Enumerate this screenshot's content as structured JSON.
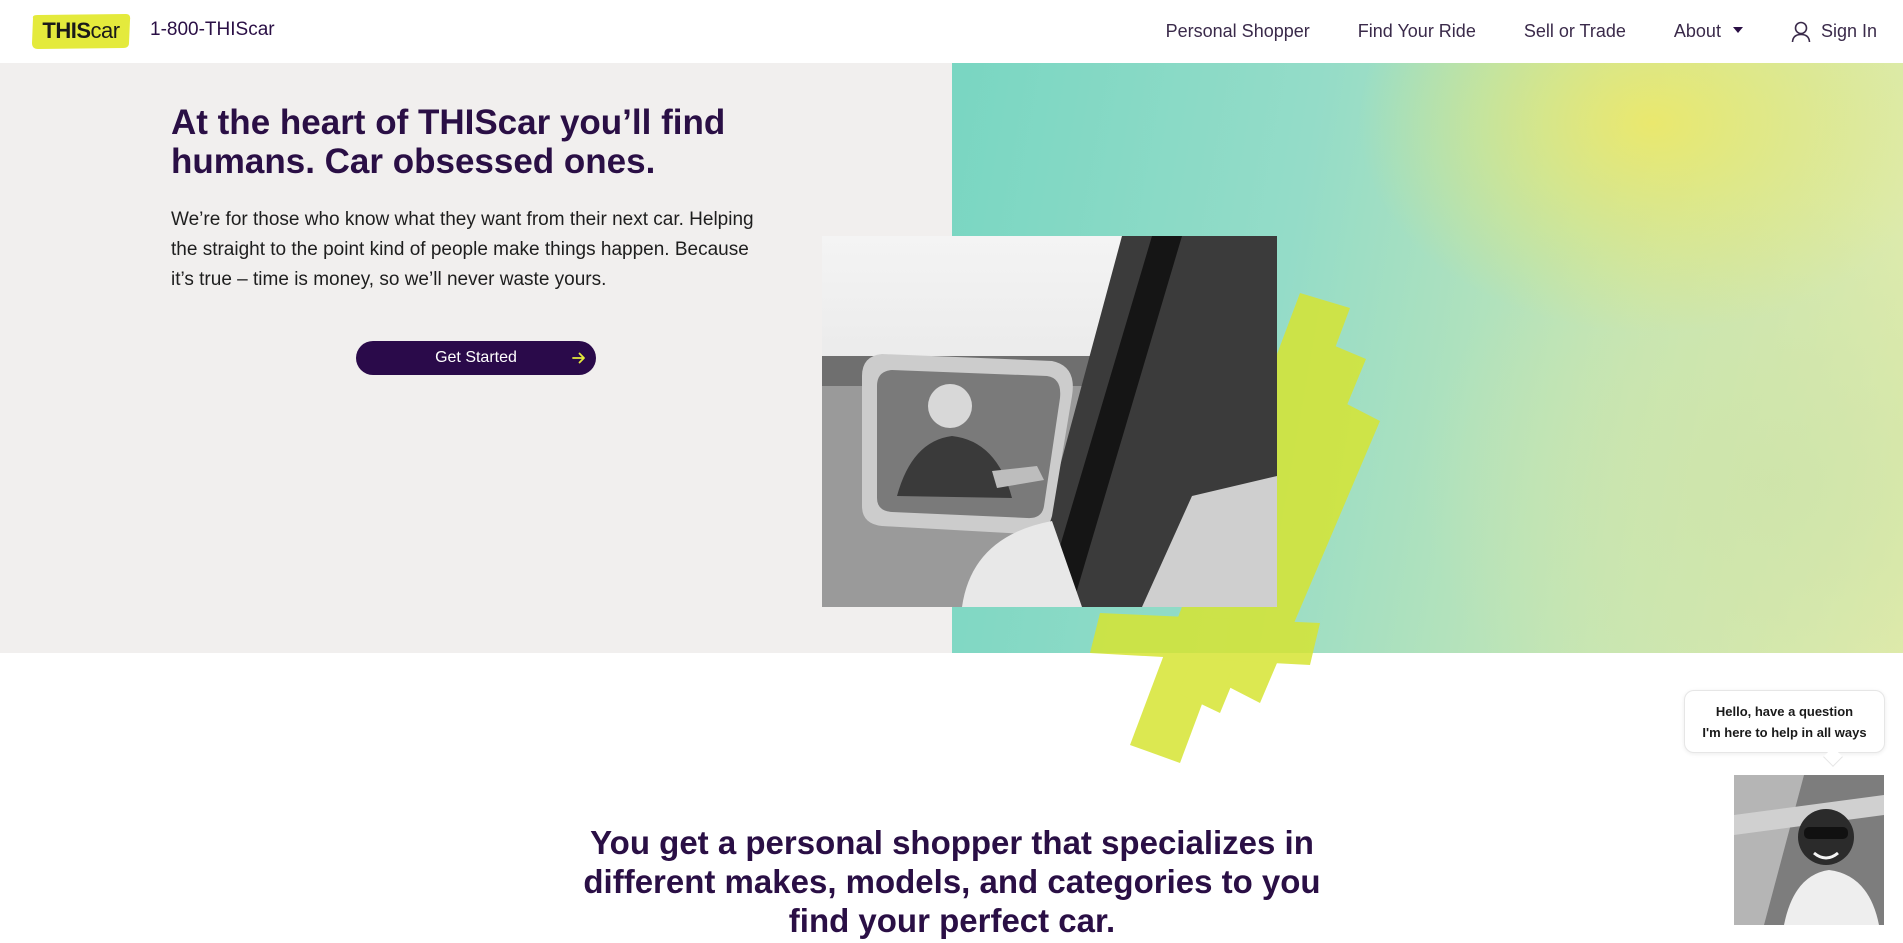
{
  "header": {
    "logo_alt": "THIScar",
    "logo_bold": "THIS",
    "logo_light": "car",
    "phone": "1-800-THIScar",
    "nav": [
      {
        "label": "Personal Shopper"
      },
      {
        "label": "Find Your Ride"
      },
      {
        "label": "Sell or Trade"
      },
      {
        "label": "About"
      }
    ],
    "sign_in": "Sign In"
  },
  "hero": {
    "title": "At the heart of THIScar you’ll find humans. Car obsessed ones.",
    "body": "We’re for those who know what they want from their next car. Helping the straight to the point kind of people make things happen. Because it’s true – time is money, so we’ll never waste yours.",
    "cta_label": "Get Started"
  },
  "section2": {
    "title": "You get a personal shopper that specializes in different makes, models, and categories to you find your perfect car."
  },
  "chat": {
    "line1": "Hello, have a question",
    "line2": "I'm here to help in all ways"
  },
  "colors": {
    "brand_purple": "#2a0a4a",
    "brand_yellow": "#e4ea3c",
    "hero_left_bg": "#f1efee"
  },
  "icons": [
    "user-icon",
    "chevron-down-icon",
    "arrow-right-icon"
  ]
}
